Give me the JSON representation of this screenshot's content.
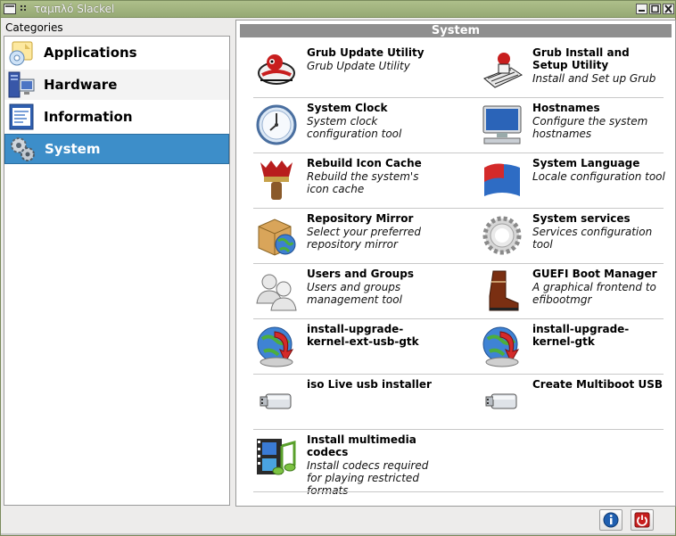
{
  "window": {
    "title": "ταμπλό Slackel"
  },
  "sidebar": {
    "header": "Categories",
    "items": [
      {
        "label": "Applications",
        "icon": "applications-icon"
      },
      {
        "label": "Hardware",
        "icon": "hardware-icon"
      },
      {
        "label": "Information",
        "icon": "information-icon"
      },
      {
        "label": "System",
        "icon": "system-gear-icon",
        "selected": true
      }
    ]
  },
  "main": {
    "section_title": "System",
    "tools": [
      {
        "title": "Grub Update Utility",
        "desc": "Grub Update Utility",
        "icon": "grub-update-icon"
      },
      {
        "title": "Grub Install and Setup Utility",
        "desc": "Install and Set up Grub",
        "icon": "grub-install-icon"
      },
      {
        "title": "System Clock",
        "desc": "System clock configuration tool",
        "icon": "clock-icon"
      },
      {
        "title": "Hostnames",
        "desc": "Configure the system hostnames",
        "icon": "monitor-icon"
      },
      {
        "title": "Rebuild Icon Cache",
        "desc": "Rebuild the system's icon cache",
        "icon": "brush-icon"
      },
      {
        "title": "System Language",
        "desc": "Locale configuration tool",
        "icon": "flag-icon"
      },
      {
        "title": "Repository Mirror",
        "desc": "Select your preferred repository mirror",
        "icon": "repository-globe-icon"
      },
      {
        "title": "System services",
        "desc": "Services configuration tool",
        "icon": "services-gear-icon"
      },
      {
        "title": "Users and Groups",
        "desc": "Users and groups management tool",
        "icon": "users-icon"
      },
      {
        "title": "GUEFI Boot Manager",
        "desc": "A graphical frontend to efibootmgr",
        "icon": "boot-icon"
      },
      {
        "title": "install-upgrade-kernel-ext-usb-gtk",
        "desc": "",
        "icon": "kernel-upgrade-icon"
      },
      {
        "title": "install-upgrade-kernel-gtk",
        "desc": "",
        "icon": "kernel-upgrade-icon"
      },
      {
        "title": "iso Live usb installer",
        "desc": "",
        "icon": "usb-stick-icon"
      },
      {
        "title": "Create Multiboot USB",
        "desc": "",
        "icon": "usb-stick-icon"
      },
      {
        "title": "Install multimedia codecs",
        "desc": "Install codecs required for playing restricted formats",
        "icon": "multimedia-icon"
      }
    ]
  },
  "footer": {
    "about_icon": "info-icon",
    "quit_icon": "power-icon"
  },
  "colors": {
    "titlebar": "#a4b67f",
    "selection": "#3d8ec9",
    "section_header": "#8f8f8f"
  }
}
